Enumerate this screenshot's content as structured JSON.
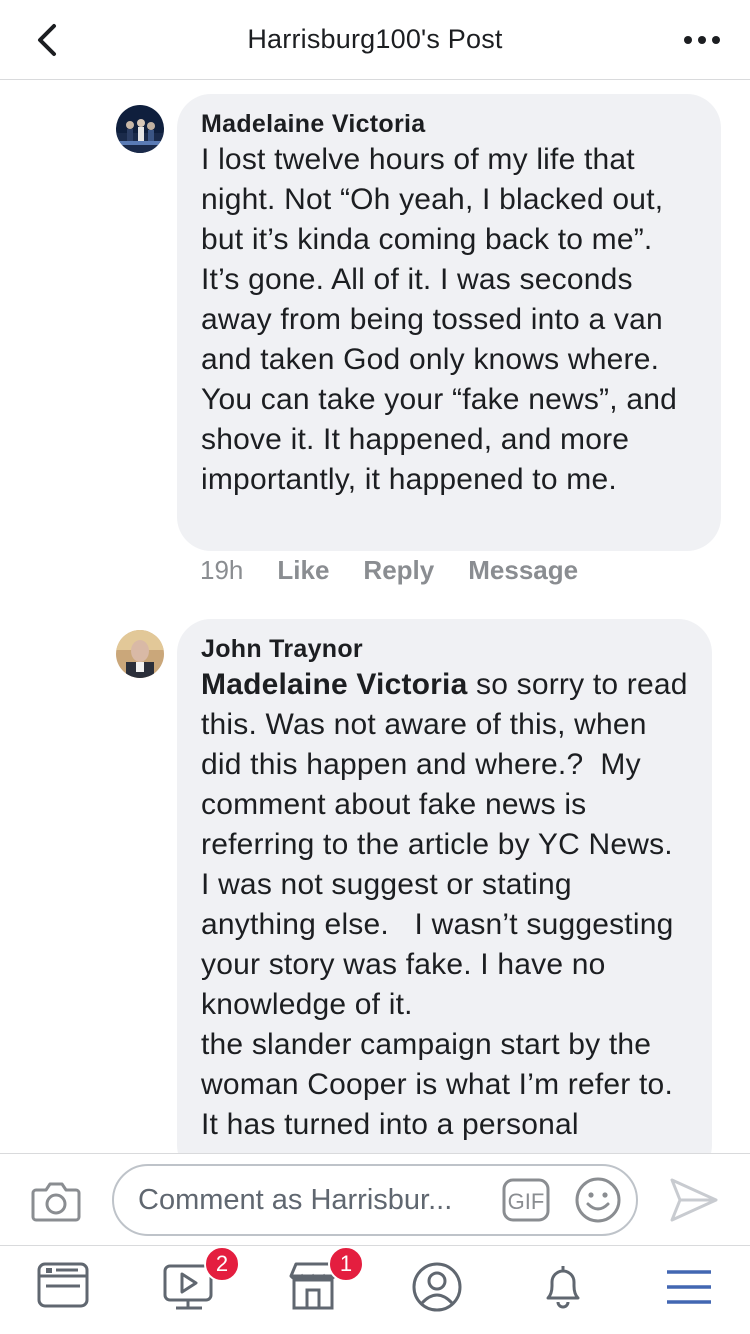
{
  "header": {
    "title": "Harrisburg100's Post",
    "back_icon": "chevron-left-icon",
    "more_icon": "more-horizontal-icon"
  },
  "comments": [
    {
      "author": "Madelaine Victoria",
      "body": "I lost twelve hours of my life that night. Not “Oh yeah, I blacked out, but it’s kinda coming back to me”. It’s gone. All of it. I was seconds away from being tossed into a van and taken God only knows where. You can take your “fake news”, and shove it. It happened, and more importantly, it happened to me.",
      "time": "19h",
      "like": "Like",
      "reply": "Reply",
      "message": "Message"
    },
    {
      "author": "John Traynor",
      "mention": "Madelaine Victoria",
      "body": " so sorry to read this. Was not aware of this, when did this happen and where.?  My comment about fake news is referring to the article by YC News. I was not suggest or stating anything else.   I wasn’t suggesting your story was fake. I have no knowledge of it.\nthe slander campaign start by the woman Cooper is what I’m refer to. It has turned into a personal"
    }
  ],
  "composer": {
    "placeholder": "Comment as Harrisbur...",
    "gif_label": "GIF"
  },
  "bottom_nav": {
    "watch_badge": "2",
    "marketplace_badge": "1"
  },
  "colors": {
    "accent": "#4267b2",
    "bubble": "#f0f1f4",
    "badge": "#e41e3f"
  }
}
